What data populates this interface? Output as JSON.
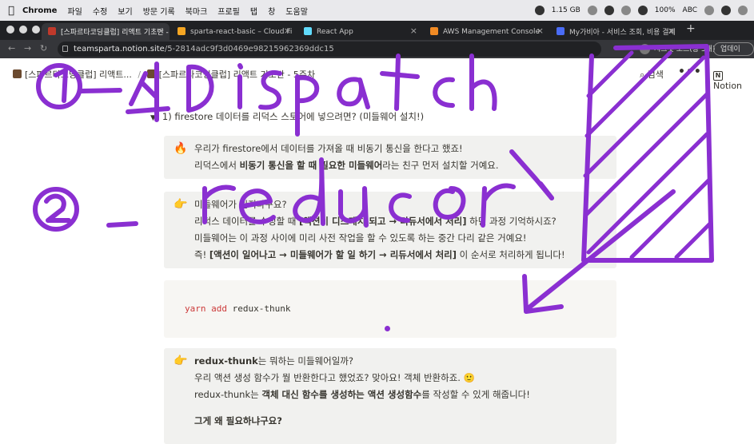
{
  "menubar": {
    "app": "Chrome",
    "items": [
      "파일",
      "수정",
      "보기",
      "방문 기록",
      "북마크",
      "프로필",
      "탭",
      "창",
      "도움말"
    ],
    "memory": "1.15 GB",
    "battery": "100%",
    "input": "ABC"
  },
  "tabs": [
    {
      "title": "[스파르타코딩클럽] 리액트 기초반 -",
      "favicon_color": "#c0392b",
      "active": true
    },
    {
      "title": "sparta-react-basic – Cloud Fi",
      "favicon_color": "#f5a623",
      "active": false
    },
    {
      "title": "React App",
      "favicon_color": "#61dafb",
      "active": false
    },
    {
      "title": "AWS Management Console",
      "favicon_color": "#f08a24",
      "active": false
    },
    {
      "title": "My가비아 - 서비스 조회, 비용 결제",
      "favicon_color": "#4a6cf7",
      "active": false
    }
  ],
  "address": {
    "host": "teamsparta.notion.site",
    "path": "/5-2814adc9f3d0469e98215962369ddc15",
    "incognito": "시크릿 모드(창 3개)",
    "update": "업데이트"
  },
  "notion": {
    "crumb1": "[스파르타코딩클럽] 리액트...",
    "crumb2": "[스파르타코딩클럽] 리액트 기초반 - 5주차",
    "search": "검색",
    "brand": "Notion"
  },
  "content": {
    "toggle_title": "1) firestore 데이터를 리덕스 스토어에 넣으려면? (미들웨어 설치!)",
    "callout1": {
      "emoji": "🔥",
      "line1": "우리가 firestore에서 데이터를 가져올 때 비동기 통신을 한다고 했죠!",
      "line2_pre": "리덕스에서 ",
      "line2_bold": "비동기 통신을 할 때 필요한 미들웨어",
      "line2_post": "라는 친구 먼저 설치할 거예요."
    },
    "callout2": {
      "emoji": "👉",
      "line1": "미들웨어가 뭔지나구요?",
      "line2_pre": "리덕스 데이터를 수정할 때 ",
      "line2_bold": "[액션이 디스패치 되고 → 리듀서에서 처리]",
      "line2_post": " 하던 과정 기억하시죠?",
      "line3": "미들웨어는 이 과정 사이에 미리 사전 작업을 할 수 있도록 하는 중간 다리 같은 거예요!",
      "line4_pre": "즉! ",
      "line4_bold": "[액션이 일어나고 → 미들웨어가 할 일 하기 → 리듀서에서 처리]",
      "line4_post": " 이 순서로 처리하게 됩니다!"
    },
    "code": {
      "cmd": "yarn",
      "sub": "add",
      "pkg": "redux-thunk"
    },
    "callout3": {
      "emoji": "👉",
      "line1_bold": "redux-thunk",
      "line1_post": "는 뭐하는 미들웨어일까?",
      "line2": "우리 액션 생성 함수가 뭘 반환한다고 했었죠? 맞아요! 객체 반환하죠. 🙂",
      "line3_pre": "redux-thunk는 ",
      "line3_bold": "객체 대신 함수를 생성하는 액션 생성함수",
      "line3_post": "를 작성할 수 있게 해줍니다!",
      "line4": "그게 왜 필요하냐구요?"
    }
  },
  "annotations": {
    "note1": "①—쉬 Dispatch",
    "note2": "②—reducer",
    "ink_color": "#8a2fd1"
  }
}
